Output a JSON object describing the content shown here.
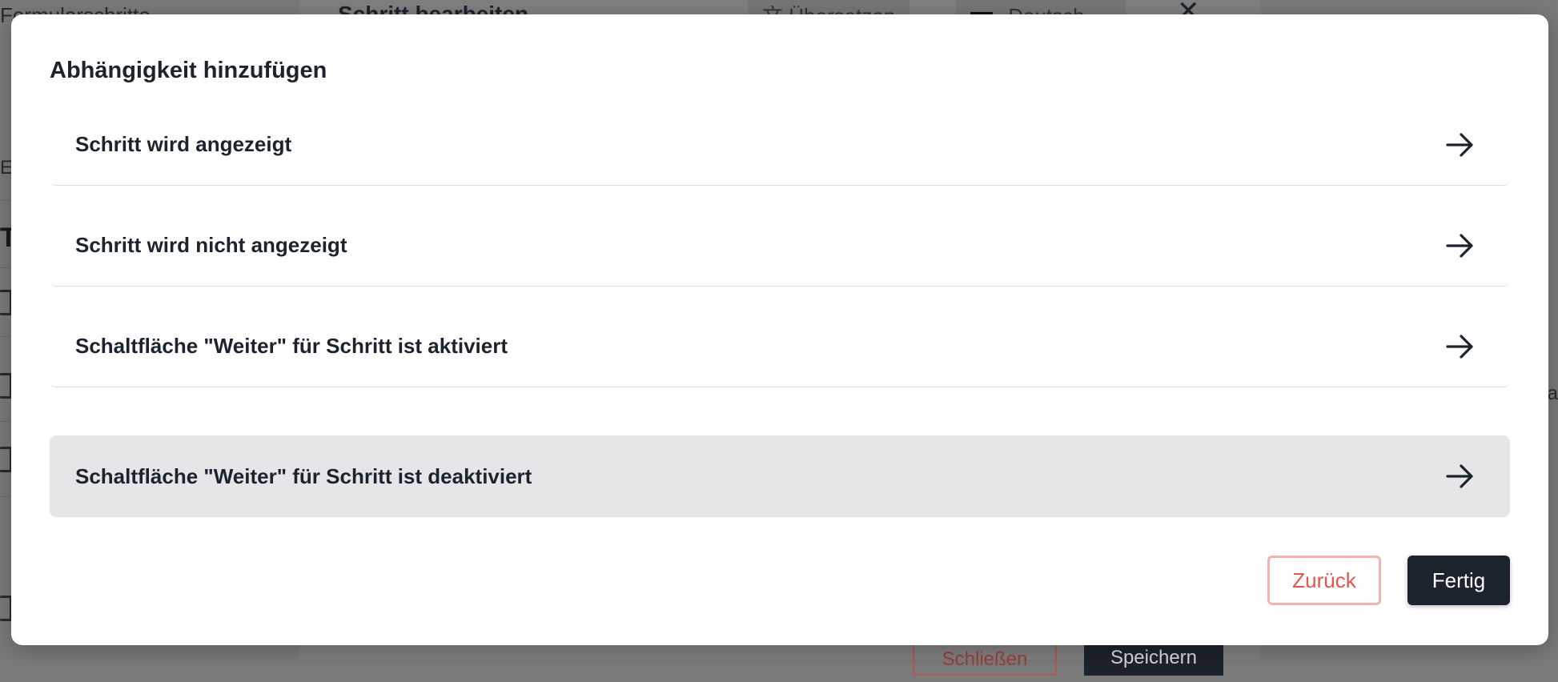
{
  "background": {
    "left_title_fragment": "Formularschritte",
    "left_text_fragment": "Es",
    "left_heading_fragment": "T",
    "dialog_title": "Schritt bearbeiten",
    "translate_label": "Übersetzen",
    "language_label": "Deutsch",
    "close_label": "✕",
    "close_button_label": "Schließen",
    "save_button_label": "Speichern",
    "right_text_fragment": "a"
  },
  "modal": {
    "title": "Abhängigkeit hinzufügen",
    "options": [
      {
        "label": "Schritt wird angezeigt",
        "icon": "arrow-right-icon",
        "active": false
      },
      {
        "label": "Schritt wird nicht angezeigt",
        "icon": "arrow-right-icon",
        "active": false
      },
      {
        "label": "Schaltfläche \"Weiter\" für Schritt ist aktiviert",
        "icon": "arrow-right-icon",
        "active": false
      },
      {
        "label": "Schaltfläche \"Weiter\" für Schritt ist deaktiviert",
        "icon": "arrow-right-icon",
        "active": true
      }
    ],
    "back_label": "Zurück",
    "done_label": "Fertig"
  },
  "colors": {
    "primary": "#1d232c",
    "danger": "#e0574d",
    "danger_border": "#f2b3ae",
    "active_option_bg": "#e6e6e8",
    "overlay": "#7b7b7b"
  }
}
